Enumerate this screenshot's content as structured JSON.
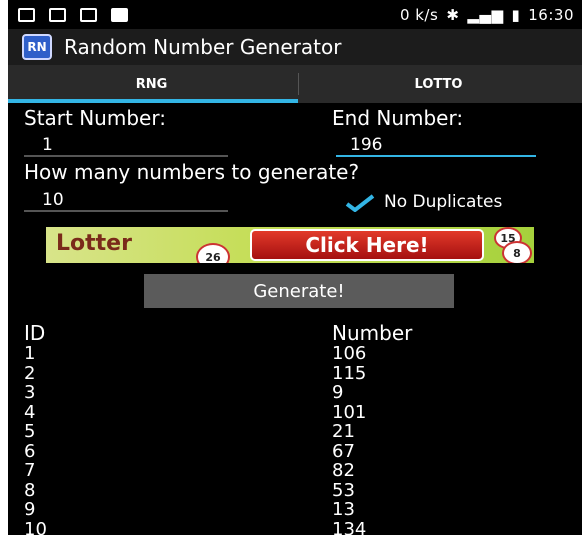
{
  "status_bar": {
    "net_speed": "0 k/s",
    "time": "16:30"
  },
  "app": {
    "icon_text": "RN",
    "title": "Random Number Generator"
  },
  "tabs": [
    {
      "label": "RNG",
      "selected": true
    },
    {
      "label": "LOTTO",
      "selected": false
    }
  ],
  "form": {
    "start_label": "Start Number:",
    "start_value": "1",
    "end_label": "End Number:",
    "end_value": "196",
    "count_label": "How many numbers to generate?",
    "count_value": "10",
    "no_duplicates_label": "No Duplicates",
    "no_duplicates_checked": true
  },
  "ad": {
    "logo": "Lotter",
    "button": "Click Here!",
    "balls": [
      "26",
      "15",
      "8"
    ]
  },
  "generate_label": "Generate!",
  "results": {
    "id_header": "ID",
    "number_header": "Number",
    "rows": [
      {
        "id": "1",
        "number": "106"
      },
      {
        "id": "2",
        "number": "115"
      },
      {
        "id": "3",
        "number": "9"
      },
      {
        "id": "4",
        "number": "101"
      },
      {
        "id": "5",
        "number": "21"
      },
      {
        "id": "6",
        "number": "67"
      },
      {
        "id": "7",
        "number": "82"
      },
      {
        "id": "8",
        "number": "53"
      },
      {
        "id": "9",
        "number": "13"
      },
      {
        "id": "10",
        "number": "134"
      }
    ]
  },
  "colors": {
    "accent": "#33b5e5",
    "button_bg": "#5b5b5b",
    "ad_button": "#d42a1a"
  }
}
